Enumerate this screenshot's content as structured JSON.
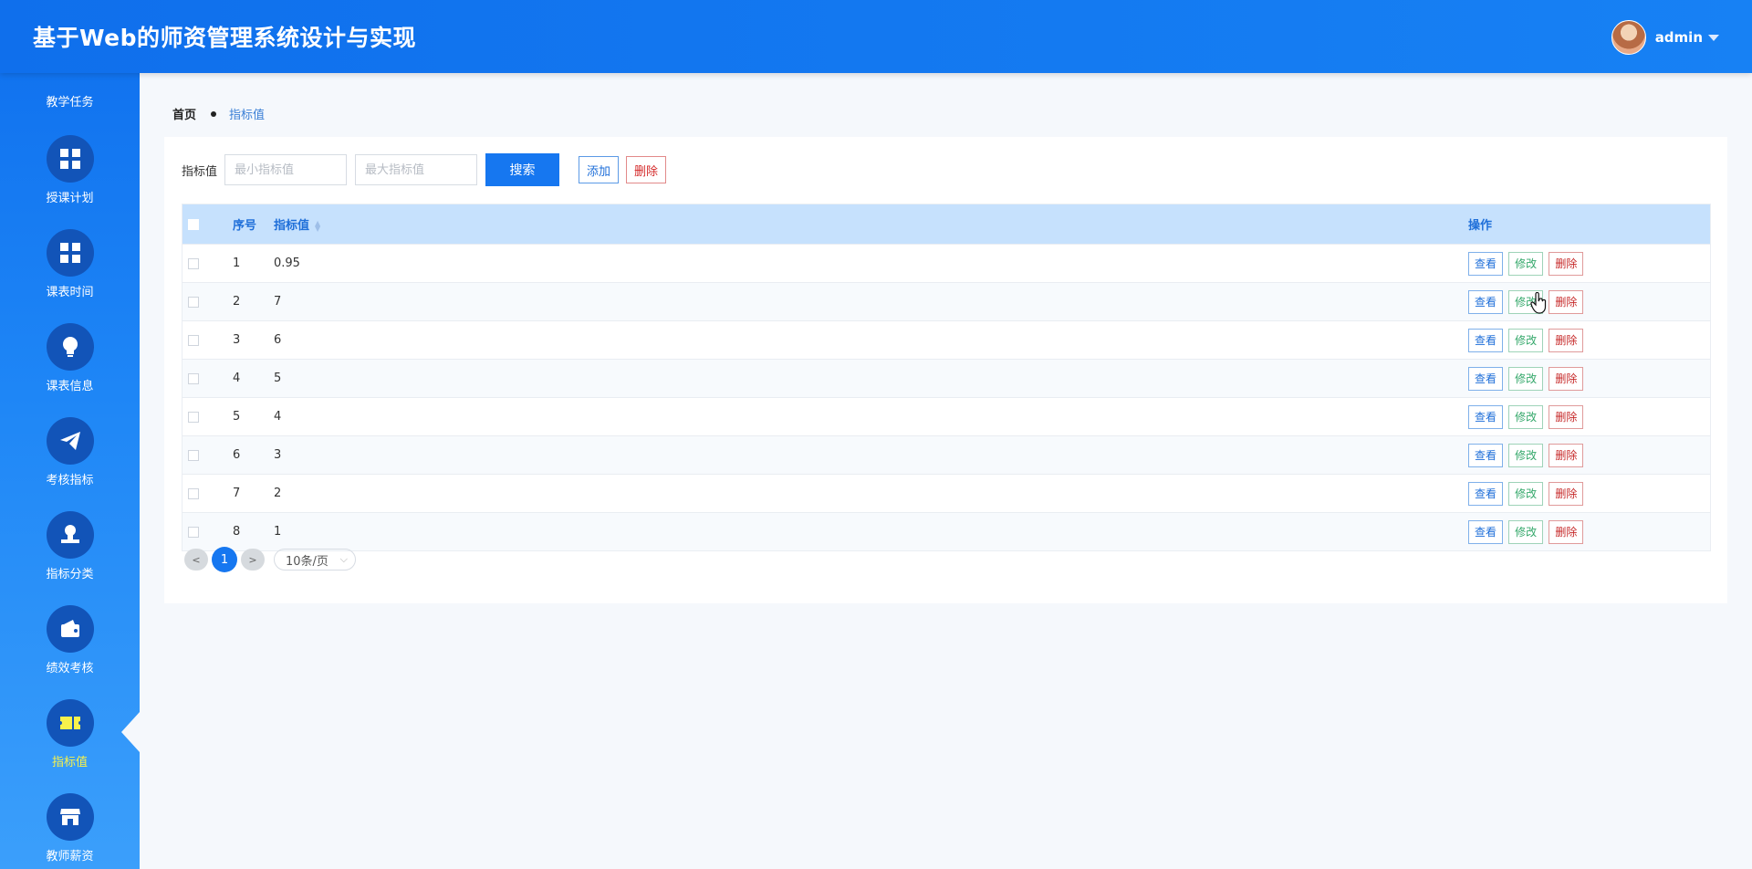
{
  "app": {
    "title": "基于Web的师资管理系统设计与实现"
  },
  "user": {
    "name": "admin"
  },
  "sidebar": {
    "items": [
      {
        "label": "教学任务",
        "icon": "none"
      },
      {
        "label": "授课计划",
        "icon": "grid-icon"
      },
      {
        "label": "课表时间",
        "icon": "grid-icon"
      },
      {
        "label": "课表信息",
        "icon": "lightbulb-icon"
      },
      {
        "label": "考核指标",
        "icon": "paper-plane-icon"
      },
      {
        "label": "指标分类",
        "icon": "stamp-icon"
      },
      {
        "label": "绩效考核",
        "icon": "wallet-icon"
      },
      {
        "label": "指标值",
        "icon": "ticket-icon",
        "active": true
      },
      {
        "label": "教师薪资",
        "icon": "store-icon"
      }
    ]
  },
  "breadcrumb": {
    "home": "首页",
    "current": "指标值"
  },
  "search": {
    "label": "指标值",
    "min_placeholder": "最小指标值",
    "max_placeholder": "最大指标值",
    "search_button": "搜索",
    "add_button": "添加",
    "delete_button": "删除"
  },
  "table": {
    "headers": {
      "no": "序号",
      "value": "指标值",
      "ops": "操作"
    },
    "actions": {
      "view": "查看",
      "edit": "修改",
      "delete": "删除"
    },
    "rows": [
      {
        "no": "1",
        "value": "0.95"
      },
      {
        "no": "2",
        "value": "7"
      },
      {
        "no": "3",
        "value": "6"
      },
      {
        "no": "4",
        "value": "5"
      },
      {
        "no": "5",
        "value": "4"
      },
      {
        "no": "6",
        "value": "3"
      },
      {
        "no": "7",
        "value": "2"
      },
      {
        "no": "8",
        "value": "1"
      }
    ]
  },
  "pagination": {
    "prev": "<",
    "current": "1",
    "next": ">",
    "page_size": "10条/页"
  },
  "colors": {
    "primary": "#1677f0",
    "header_bg": "#1781f4",
    "active_menu": "#f7f24b",
    "table_header": "#c6e1fd"
  }
}
